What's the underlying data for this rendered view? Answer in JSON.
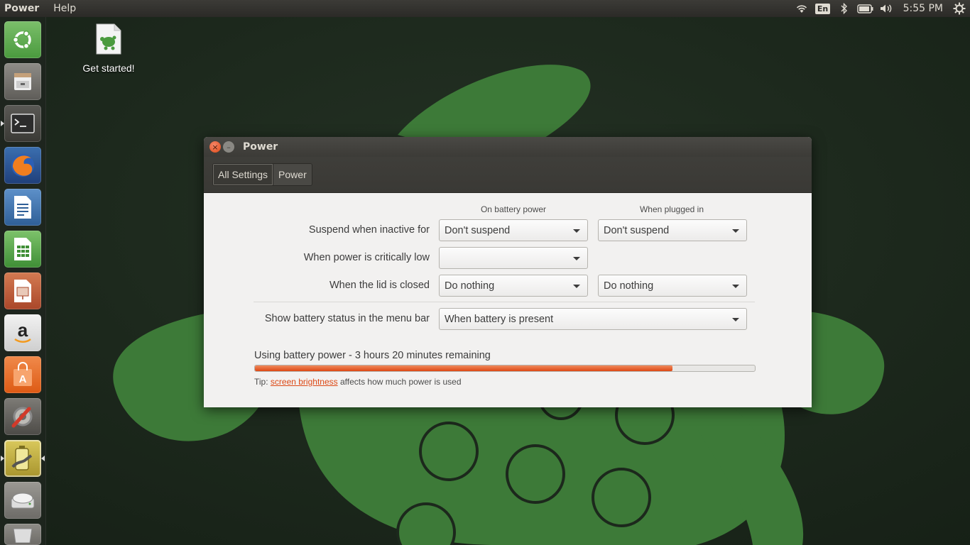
{
  "panel": {
    "app_menu": "Power",
    "help_menu": "Help",
    "keyboard_layout": "En",
    "clock": "5:55 PM"
  },
  "desktop": {
    "icon_label": "Get started!"
  },
  "launcher": {
    "items": [
      "ubuntu-dash",
      "files",
      "terminal",
      "firefox",
      "libreoffice-writer",
      "libreoffice-calc",
      "libreoffice-impress",
      "amazon",
      "ubuntu-software",
      "system-settings",
      "power-statistics",
      "disks",
      "trash"
    ]
  },
  "window": {
    "title": "Power",
    "breadcrumbs": [
      "All Settings",
      "Power"
    ],
    "columns": {
      "battery": "On battery power",
      "plugged": "When plugged in"
    },
    "rows": {
      "suspend_label": "Suspend when inactive for",
      "suspend_battery": "Don't suspend",
      "suspend_plugged": "Don't suspend",
      "critical_label": "When power is critically low",
      "critical_battery": "",
      "lid_label": "When the lid is closed",
      "lid_battery": "Do nothing",
      "lid_plugged": "Do nothing",
      "status_label": "Show battery status in the menu bar",
      "status_value": "When battery is present"
    },
    "battery_status": "Using battery power - 3 hours 20 minutes remaining",
    "battery_level": 0.835,
    "tip_prefix": "Tip:",
    "tip_link": "screen brightness",
    "tip_suffix": "affects how much power is used"
  },
  "colors": {
    "accent": "#dd4814",
    "panel": "#2b2a27",
    "wallpaper_green": "#3f8a3a"
  }
}
